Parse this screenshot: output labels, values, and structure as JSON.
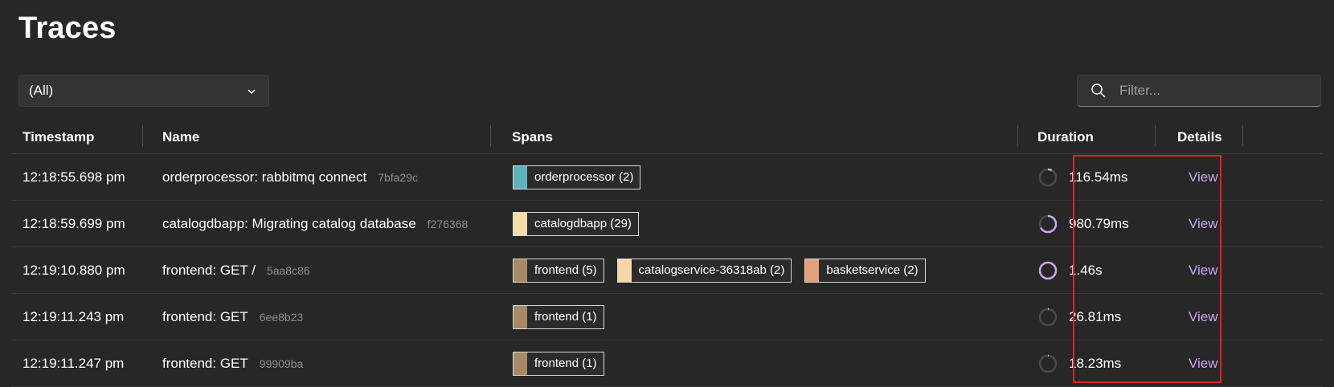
{
  "page": {
    "title": "Traces"
  },
  "toolbar": {
    "select_value": "(All)",
    "filter_placeholder": "Filter..."
  },
  "columns": {
    "timestamp": "Timestamp",
    "name": "Name",
    "spans": "Spans",
    "duration": "Duration",
    "details": "Details"
  },
  "colors": {
    "orderprocessor": "#5fb3b9",
    "catalogdbapp": "#f6dfa6",
    "frontend": "#a68a64",
    "catalogservice": "#f7d6a8",
    "basketservice": "#e3a079",
    "link": "#c9a5f5",
    "duration_ring": "#c9a5f5",
    "highlight": "#e0202a"
  },
  "rows": [
    {
      "timestamp": "12:18:55.698 pm",
      "name": "orderprocessor: rabbitmq connect",
      "trace_id": "7bfa29c",
      "spans": [
        {
          "label": "orderprocessor (2)",
          "color": "#5fb3b9"
        }
      ],
      "duration": "116.54ms",
      "duration_fraction": 0.08,
      "details": "View"
    },
    {
      "timestamp": "12:18:59.699 pm",
      "name": "catalogdbapp: Migrating catalog database",
      "trace_id": "f276368",
      "spans": [
        {
          "label": "catalogdbapp (29)",
          "color": "#f6dfa6"
        }
      ],
      "duration": "980.79ms",
      "duration_fraction": 0.67,
      "details": "View"
    },
    {
      "timestamp": "12:19:10.880 pm",
      "name": "frontend: GET /",
      "trace_id": "5aa8c86",
      "spans": [
        {
          "label": "frontend (5)",
          "color": "#a68a64"
        },
        {
          "label": "catalogservice-36318ab (2)",
          "color": "#f7d6a8"
        },
        {
          "label": "basketservice (2)",
          "color": "#e3a079"
        }
      ],
      "duration": "1.46s",
      "duration_fraction": 1.0,
      "details": "View"
    },
    {
      "timestamp": "12:19:11.243 pm",
      "name": "frontend: GET",
      "trace_id": "6ee8b23",
      "spans": [
        {
          "label": "frontend (1)",
          "color": "#a68a64"
        }
      ],
      "duration": "26.81ms",
      "duration_fraction": 0.02,
      "details": "View"
    },
    {
      "timestamp": "12:19:11.247 pm",
      "name": "frontend: GET",
      "trace_id": "99909ba",
      "spans": [
        {
          "label": "frontend (1)",
          "color": "#a68a64"
        }
      ],
      "duration": "18.23ms",
      "duration_fraction": 0.01,
      "details": "View"
    }
  ]
}
